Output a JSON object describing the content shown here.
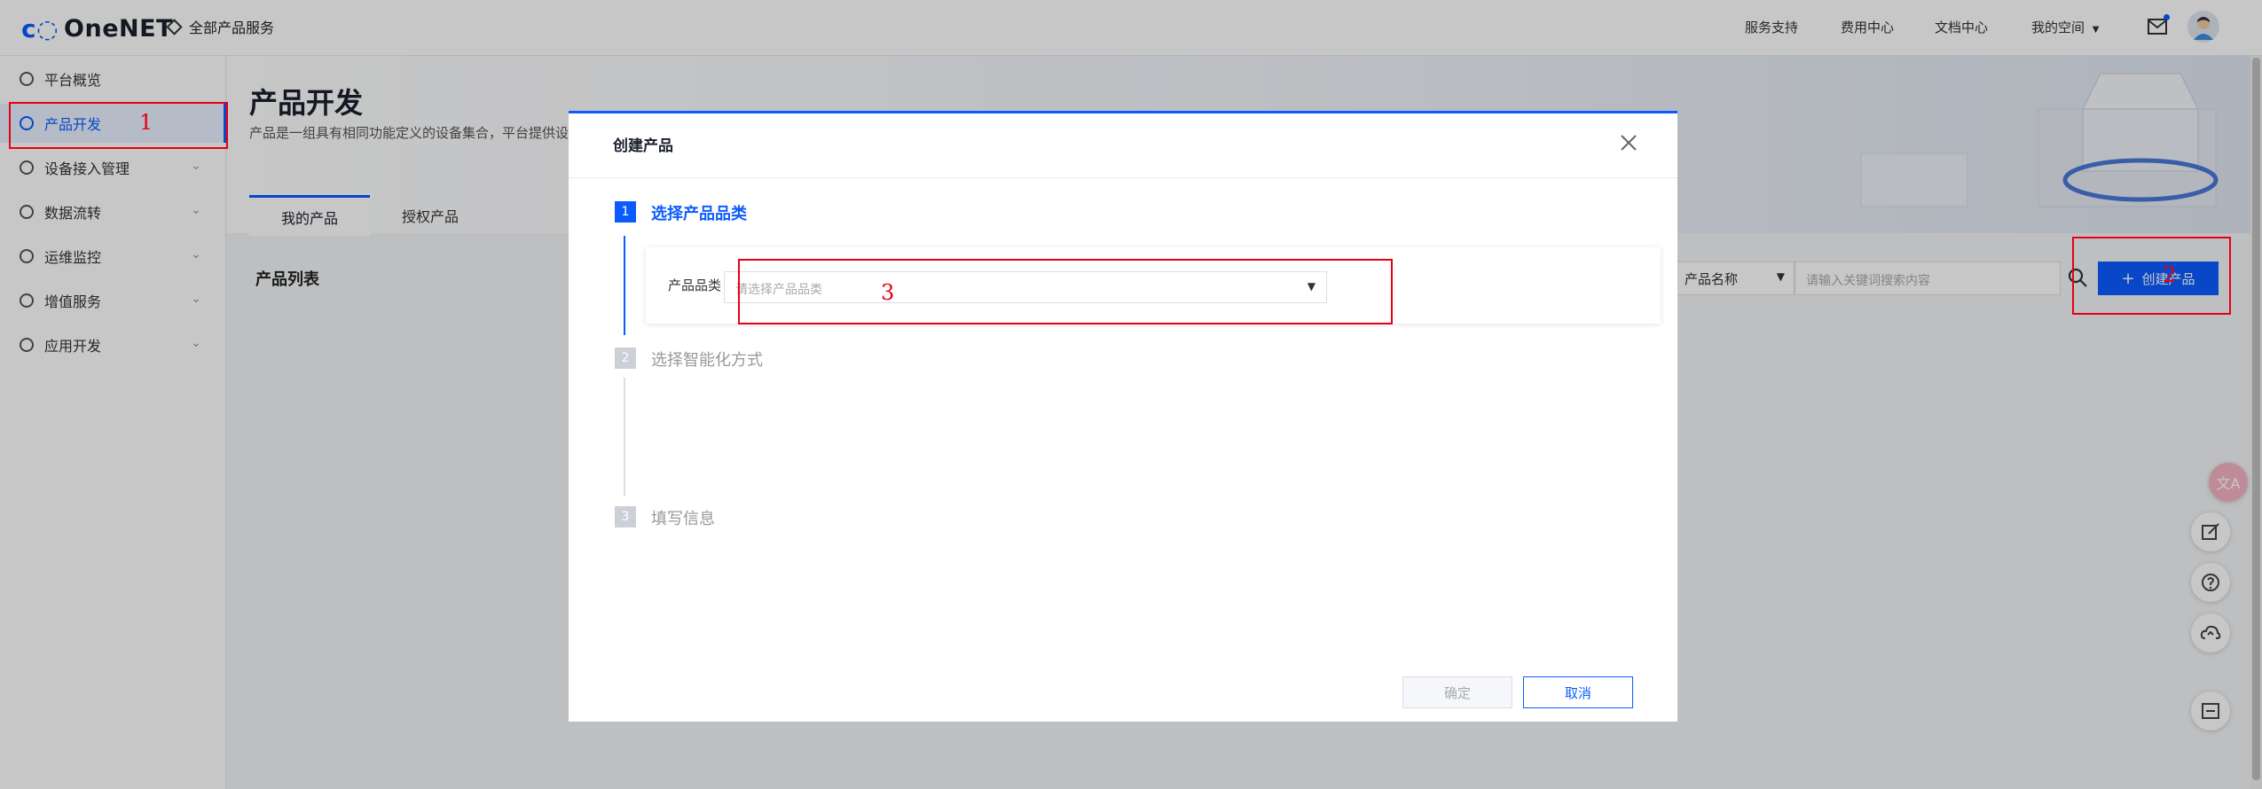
{
  "header": {
    "logo_text": "OneNET",
    "all_services": "全部产品服务",
    "nav": [
      "服务支持",
      "费用中心",
      "文档中心",
      "我的空间"
    ]
  },
  "sidebar": {
    "items": [
      {
        "label": "平台概览",
        "has_chevron": false
      },
      {
        "label": "产品开发",
        "has_chevron": false,
        "active": true
      },
      {
        "label": "设备接入管理",
        "has_chevron": true
      },
      {
        "label": "数据流转",
        "has_chevron": true
      },
      {
        "label": "运维监控",
        "has_chevron": true
      },
      {
        "label": "增值服务",
        "has_chevron": true
      },
      {
        "label": "应用开发",
        "has_chevron": true
      }
    ]
  },
  "main": {
    "title": "产品开发",
    "subtitle": "产品是一组具有相同功能定义的设备集合，平台提供设",
    "tabs": [
      "我的产品",
      "授权产品"
    ],
    "list_title": "产品列表",
    "filter_select": "产品名称",
    "search_placeholder": "请输入关键词搜索内容",
    "create_button": "创建产品"
  },
  "modal": {
    "title": "创建产品",
    "steps": [
      {
        "num": "1",
        "label": "选择产品品类"
      },
      {
        "num": "2",
        "label": "选择智能化方式"
      },
      {
        "num": "3",
        "label": "填写信息"
      }
    ],
    "category_label": "产品品类",
    "category_placeholder": "请选择产品品类",
    "ok_button": "确定",
    "cancel_button": "取消"
  },
  "annotations": [
    "1",
    "2",
    "3"
  ],
  "colors": {
    "accent": "#0b5cff",
    "annotation": "#e60012"
  }
}
